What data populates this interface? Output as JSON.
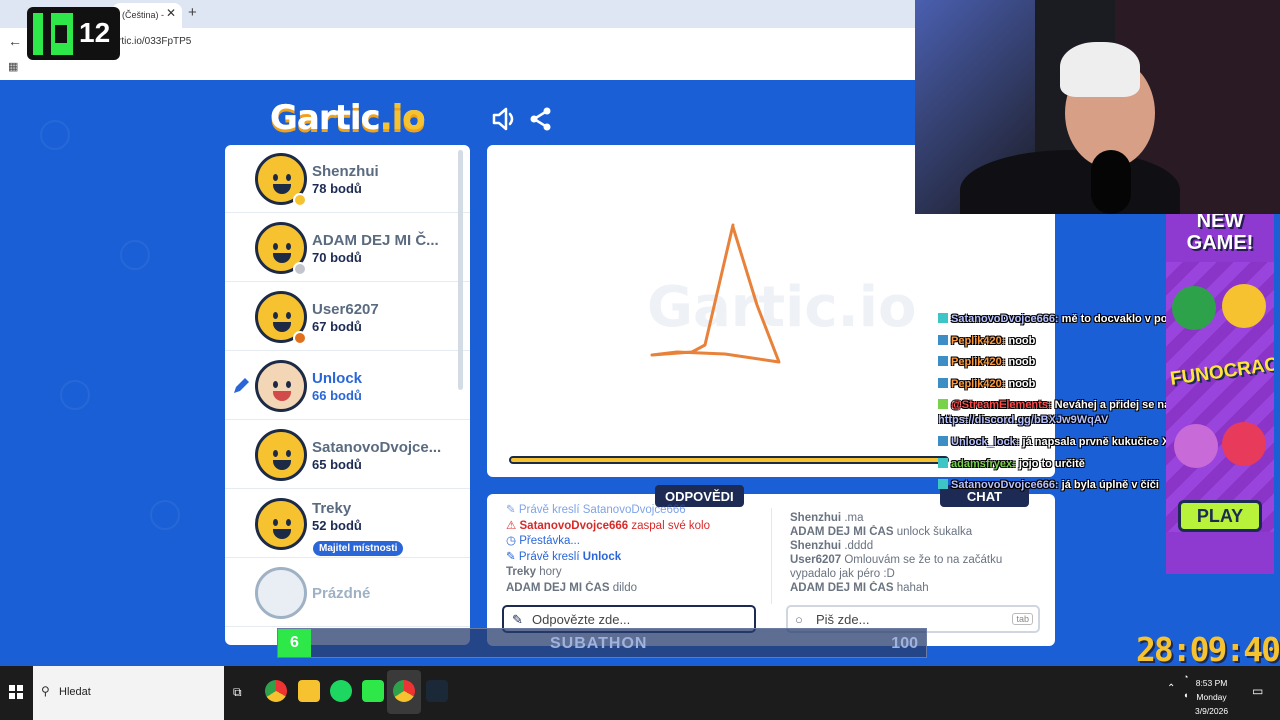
{
  "browser": {
    "tab_title": "(Čeština) -",
    "url": "rtic.io/033FpTP5"
  },
  "overlay_logo": {
    "number": "12"
  },
  "game": {
    "logo_main": "Gartic",
    "logo_suffix": ".io",
    "players": [
      {
        "name": "Shenzhui",
        "points": "78 bodů",
        "badge_color": "#f6c230"
      },
      {
        "name": "ADAM DEJ MI Č...",
        "points": "70 bodů",
        "badge_color": "#c2c6cc"
      },
      {
        "name": "User6207",
        "points": "67 bodů",
        "badge_color": "#e0701c"
      },
      {
        "name": "Unlock",
        "points": "66 bodů",
        "drawing": true
      },
      {
        "name": "SatanovoDvojce...",
        "points": "65 bodů"
      },
      {
        "name": "Treky",
        "points": "52 bodů",
        "owner_badge": "Majitel místnosti"
      },
      {
        "name": "Prázdné"
      }
    ],
    "tabs": {
      "answers": "ODPOVĚDI",
      "chat": "CHAT"
    },
    "answers_log": [
      {
        "type": "sys",
        "text": "Právě kreslí SatanovoDvojce666"
      },
      {
        "type": "warn",
        "name": "SatanovoDvojce666",
        "text": " zaspal své kolo"
      },
      {
        "type": "sys",
        "text": "Přestávka..."
      },
      {
        "type": "sys",
        "text": "Právě kreslí ",
        "name": "Unlock"
      },
      {
        "type": "msg",
        "name": "Treky",
        "text": " hory"
      },
      {
        "type": "msg",
        "name": "ADAM DEJ MI ČAS",
        "text": " dildo"
      }
    ],
    "chat_log": [
      {
        "name": "Shenzhui",
        "text": " .ma"
      },
      {
        "name": "ADAM DEJ MI ČAS",
        "text": " unlock šukalka"
      },
      {
        "name": "Shenzhui",
        "text": " .dddd"
      },
      {
        "name": "User6207",
        "text": " Omlouvám se že to na začátku"
      },
      {
        "name": "",
        "text": "vypadalo jak péro :D"
      },
      {
        "name": "ADAM DEJ MI ČAS",
        "text": " hahah"
      }
    ],
    "answer_placeholder": "Odpovězte zde...",
    "chat_placeholder": "Piš zde...",
    "chat_key_hint": "tab"
  },
  "twitch_chat": [
    {
      "user": "SatanovoDvojce666:",
      "text": " mě to docvaklo v poslední chvíli :D",
      "color": "blue"
    },
    {
      "user": "Peplik420:",
      "text": " noob",
      "color": "orange"
    },
    {
      "user": "Peplik420:",
      "text": " noob",
      "color": "orange"
    },
    {
      "user": "Peplik420:",
      "text": " noob",
      "color": "orange"
    },
    {
      "user": "@StreamElements:",
      "text": " Neváhej a přidej se na Discord ->",
      "color": "red"
    },
    {
      "user": "",
      "text": "https://discord.gg/bBXJw9WqAV",
      "color": "blue"
    },
    {
      "user": "Unlock_lock:",
      "text": " já napsala prvně kukučice XD",
      "color": "blue"
    },
    {
      "user": "adamsfryex:",
      "text": " jojo to určitě",
      "color": "green"
    },
    {
      "user": "SatanovoDvojce666:",
      "text": " já byla úplně v číči",
      "color": "blue"
    }
  ],
  "ad": {
    "headline": "NEW GAME!",
    "title": "FUNOCRACY",
    "play": "PLAY"
  },
  "subathon": {
    "count": "6",
    "label": "SUBATHON",
    "goal": "100"
  },
  "stream_timer": "28:09:40",
  "taskbar": {
    "search": "Hledat",
    "time": "8:53 PM",
    "day": "Monday",
    "date": "3/9/2026"
  }
}
